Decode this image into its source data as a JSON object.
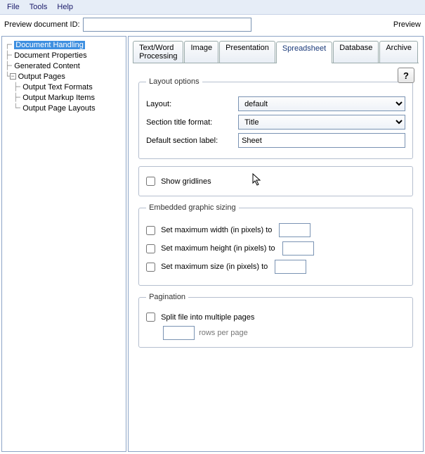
{
  "menu": {
    "file": "File",
    "tools": "Tools",
    "help": "Help"
  },
  "topbar": {
    "label": "Preview document ID:",
    "value": "",
    "button": "Preview"
  },
  "tree": {
    "doc_handling": "Document Handling",
    "doc_props": "Document Properties",
    "gen_content": "Generated Content",
    "output_pages": "Output Pages",
    "out_text": "Output Text Formats",
    "out_markup": "Output Markup Items",
    "out_layouts": "Output Page Layouts"
  },
  "tabs": {
    "text": "Text/Word Processing",
    "image": "Image",
    "presentation": "Presentation",
    "spreadsheet": "Spreadsheet",
    "database": "Database",
    "archive": "Archive"
  },
  "help_btn": "?",
  "layout": {
    "legend": "Layout options",
    "layout_label": "Layout:",
    "layout_value": "default",
    "section_title_label": "Section title format:",
    "section_title_value": "Title",
    "default_section_label": "Default section label:",
    "default_section_value": "Sheet"
  },
  "gridlines": {
    "label": "Show gridlines"
  },
  "graphic": {
    "legend": "Embedded graphic sizing",
    "max_width": "Set maximum width (in pixels) to",
    "max_height": "Set maximum height (in pixels) to",
    "max_size": "Set maximum size (in pixels) to",
    "w": "",
    "h": "",
    "s": ""
  },
  "pagination": {
    "legend": "Pagination",
    "split": "Split file into multiple pages",
    "rows_value": "",
    "rows_suffix": "rows per page"
  }
}
